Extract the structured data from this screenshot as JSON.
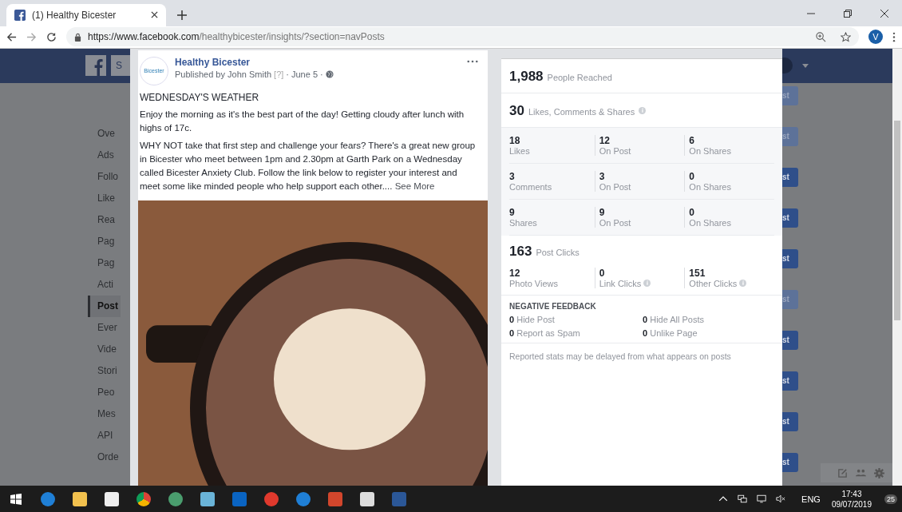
{
  "browser": {
    "tab": {
      "title": "(1) Healthy Bicester",
      "selected": true
    },
    "url": {
      "host": "https://www.facebook.com",
      "path": "/healthybicester/insights/?section=navPosts"
    },
    "profile_initial": "V"
  },
  "sidebar": {
    "header_cut": "S",
    "items": [
      {
        "label": "Ove",
        "selected": false
      },
      {
        "label": "Ads",
        "selected": false
      },
      {
        "label": "Follo",
        "selected": false
      },
      {
        "label": "Like",
        "selected": false
      },
      {
        "label": "Rea",
        "selected": false
      },
      {
        "label": "Pag",
        "selected": false
      },
      {
        "label": "Pag",
        "selected": false
      },
      {
        "label": "Acti",
        "selected": false
      },
      {
        "label": "Post",
        "selected": true
      },
      {
        "label": "Ever",
        "selected": false
      },
      {
        "label": "Vide",
        "selected": false
      },
      {
        "label": "Stori",
        "selected": false
      },
      {
        "label": "Peo",
        "selected": false
      },
      {
        "label": "Mes",
        "selected": false
      },
      {
        "label": "API",
        "selected": false
      },
      {
        "label": "Orde",
        "selected": false
      }
    ]
  },
  "post": {
    "page_name": "Healthy Bicester",
    "avatar_text": "Bicester",
    "published_by": "Published by John Smith",
    "help": "[?]",
    "separator": "·",
    "date": "June 5",
    "title": "WEDNESDAY'S WEATHER",
    "paragraphs": [
      "Enjoy the morning as it's the best part of the day! Getting cloudy after lunch with highs of 17c.",
      "WHY NOT take that first step and challenge your fears? There's a great new group in Bicester who meet between 1pm and 2.30pm at Garth Park on a Wednesday called Bicester Anxiety Club. Follow the link below to register your interest and meet some like minded people who help support each other...."
    ],
    "see_more": "See More"
  },
  "stats": {
    "reach": {
      "value": "1,988",
      "label": "People Reached"
    },
    "engagement": {
      "value": "30",
      "label": "Likes, Comments & Shares",
      "info": true
    },
    "engagement_rows": [
      [
        {
          "value": "18",
          "label": "Likes"
        },
        {
          "value": "12",
          "label": "On Post"
        },
        {
          "value": "6",
          "label": "On Shares"
        }
      ],
      [
        {
          "value": "3",
          "label": "Comments"
        },
        {
          "value": "3",
          "label": "On Post"
        },
        {
          "value": "0",
          "label": "On Shares"
        }
      ],
      [
        {
          "value": "9",
          "label": "Shares"
        },
        {
          "value": "9",
          "label": "On Post"
        },
        {
          "value": "0",
          "label": "On Shares"
        }
      ]
    ],
    "clicks": {
      "value": "163",
      "label": "Post Clicks"
    },
    "click_items": [
      {
        "value": "12",
        "label": "Photo Views",
        "info": false
      },
      {
        "value": "0",
        "label": "Link Clicks",
        "info": true
      },
      {
        "value": "151",
        "label": "Other Clicks",
        "info": true
      }
    ],
    "negative_feedback": {
      "title": "NEGATIVE FEEDBACK",
      "items": [
        {
          "text": "**0** Hide Post"
        },
        {
          "text": "**0** Hide All Posts"
        },
        {
          "text": "**0** Report as Spam"
        },
        {
          "text": "**0** Unlike Page"
        }
      ]
    },
    "footnote": "Reported stats may be delayed from what appears on posts"
  },
  "right_buttons": [
    {
      "label": "st",
      "disabled": true
    },
    {
      "label": "st",
      "disabled": true
    },
    {
      "label": "st",
      "disabled": false
    },
    {
      "label": "st",
      "disabled": false
    },
    {
      "label": "st",
      "disabled": false
    },
    {
      "label": "st",
      "disabled": true
    },
    {
      "label": "st",
      "disabled": false
    },
    {
      "label": "st",
      "disabled": false
    },
    {
      "label": "st",
      "disabled": false
    },
    {
      "label": "st",
      "disabled": false
    }
  ],
  "taskbar": {
    "language": "ENG",
    "time": "17:43",
    "date": "09/07/2019",
    "notifications": "25"
  }
}
